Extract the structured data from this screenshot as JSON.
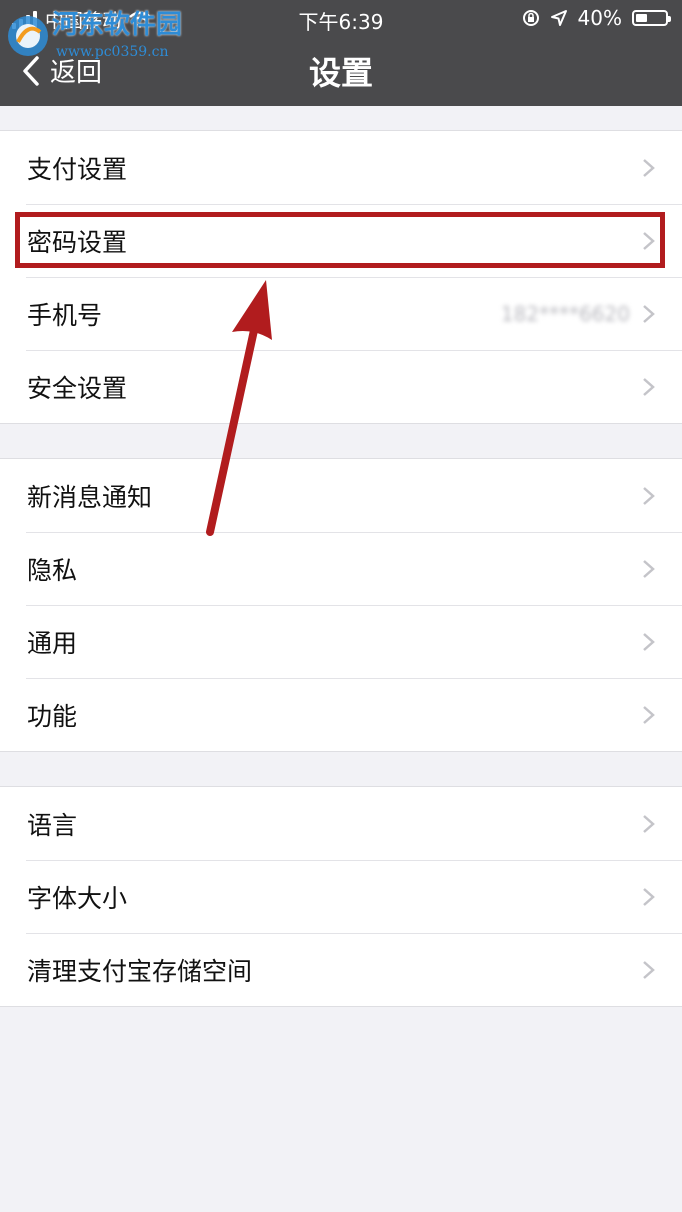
{
  "status_bar": {
    "carrier": "中国移动",
    "time": "下午6:39",
    "battery": "40%",
    "battery_level": 0.4
  },
  "watermark": {
    "text": "河东软件园",
    "url": "www.pc0359.cn"
  },
  "nav": {
    "back_label": "返回",
    "title": "设置"
  },
  "groups": [
    {
      "items": [
        {
          "label": "支付设置"
        },
        {
          "label": "密码设置"
        },
        {
          "label": "手机号",
          "value": "182****6620"
        },
        {
          "label": "安全设置"
        }
      ]
    },
    {
      "items": [
        {
          "label": "新消息通知"
        },
        {
          "label": "隐私"
        },
        {
          "label": "通用"
        },
        {
          "label": "功能"
        }
      ]
    },
    {
      "items": [
        {
          "label": "语言"
        },
        {
          "label": "字体大小"
        },
        {
          "label": "清理支付宝存储空间"
        }
      ]
    }
  ],
  "colors": {
    "header_bg": "#4A4A4C",
    "page_bg": "#F2F2F6",
    "annotation": "#B11C1E",
    "chevron": "#C4C4C9"
  }
}
